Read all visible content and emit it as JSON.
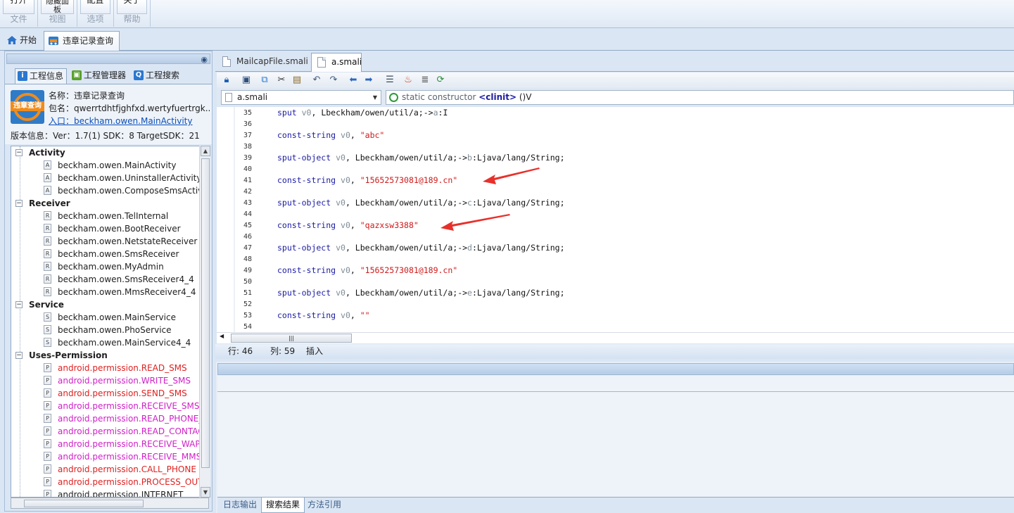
{
  "ribbon": {
    "groups": [
      {
        "button": "打开",
        "label": "文件"
      },
      {
        "button": "隐藏面板",
        "label": "视图"
      },
      {
        "button": "配置",
        "label": "选项"
      },
      {
        "button": "关于",
        "label": "帮助"
      }
    ]
  },
  "top_tabs": {
    "home": "开始",
    "project": "违章记录查询"
  },
  "left_panel": {
    "tabs": {
      "info": "工程信息",
      "manager": "工程管理器",
      "search": "工程搜索"
    },
    "app": {
      "icon_text": "违章查询",
      "name": "名称：违章记录查询",
      "package": "包名：qwerrtdhtfjghfxd.wertyfuertrgk...",
      "entry": "入口：beckham.owen.MainActivity",
      "version": "版本信息：Ver：1.7(1) SDK：8 TargetSDK：21"
    },
    "tree": {
      "activity": {
        "label": "Activity",
        "items": [
          "beckham.owen.MainActivity",
          "beckham.owen.UninstallerActivity",
          "beckham.owen.ComposeSmsActivity"
        ]
      },
      "receiver": {
        "label": "Receiver",
        "items": [
          "beckham.owen.TelInternal",
          "beckham.owen.BootReceiver",
          "beckham.owen.NetstateReceiver",
          "beckham.owen.SmsReceiver",
          "beckham.owen.MyAdmin",
          "beckham.owen.SmsReceiver4_4",
          "beckham.owen.MmsReceiver4_4"
        ]
      },
      "service": {
        "label": "Service",
        "items": [
          "beckham.owen.MainService",
          "beckham.owen.PhoService",
          "beckham.owen.MainService4_4"
        ]
      },
      "permission": {
        "label": "Uses-Permission",
        "items": [
          "android.permission.READ_SMS",
          "android.permission.WRITE_SMS",
          "android.permission.SEND_SMS",
          "android.permission.RECEIVE_SMS",
          "android.permission.READ_PHONE_STATE",
          "android.permission.READ_CONTACTS",
          "android.permission.RECEIVE_WAP_PUSH",
          "android.permission.RECEIVE_MMS",
          "android.permission.CALL_PHONE",
          "android.permission.PROCESS_OUTGOING_CALLS",
          "android.permission.INTERNET"
        ]
      },
      "icon_letters": {
        "activity": "A",
        "receiver": "R",
        "service": "S",
        "permission": "P"
      },
      "expanded_glyph": "⊟"
    }
  },
  "editor": {
    "tabs": [
      "MailcapFile.smali",
      "a.smali"
    ],
    "file_combo": "a.smali",
    "method_combo": {
      "prefix": "static constructor ",
      "name": "<clinit>",
      "suffix": " ()V"
    },
    "lines": [
      {
        "n": "35",
        "kw": "sput",
        "reg": "v0",
        "rest": ", Lbeckham/owen/util/a;->",
        "field": "a",
        "type": ":I"
      },
      {
        "n": "36"
      },
      {
        "n": "37",
        "kw": "const-string",
        "reg": "v0",
        "rest": ", ",
        "str": "\"abc\""
      },
      {
        "n": "38"
      },
      {
        "n": "39",
        "kw": "sput-object",
        "reg": "v0",
        "rest": ", Lbeckham/owen/util/a;->",
        "field": "b",
        "type": ":Ljava/lang/String;"
      },
      {
        "n": "40"
      },
      {
        "n": "41",
        "kw": "const-string",
        "reg": "v0",
        "rest": ", ",
        "str": "\"15652573081@189.cn\""
      },
      {
        "n": "42"
      },
      {
        "n": "43",
        "kw": "sput-object",
        "reg": "v0",
        "rest": ", Lbeckham/owen/util/a;->",
        "field": "c",
        "type": ":Ljava/lang/String;"
      },
      {
        "n": "44"
      },
      {
        "n": "45",
        "kw": "const-string",
        "reg": "v0",
        "rest": ", ",
        "str": "\"qazxsw3388\""
      },
      {
        "n": "46"
      },
      {
        "n": "47",
        "kw": "sput-object",
        "reg": "v0",
        "rest": ", Lbeckham/owen/util/a;->",
        "field": "d",
        "type": ":Ljava/lang/String;"
      },
      {
        "n": "48"
      },
      {
        "n": "49",
        "kw": "const-string",
        "reg": "v0",
        "rest": ", ",
        "str": "\"15652573081@189.cn\""
      },
      {
        "n": "50"
      },
      {
        "n": "51",
        "kw": "sput-object",
        "reg": "v0",
        "rest": ", Lbeckham/owen/util/a;->",
        "field": "e",
        "type": ":Ljava/lang/String;"
      },
      {
        "n": "52"
      },
      {
        "n": "53",
        "kw": "const-string",
        "reg": "v0",
        "rest": ", ",
        "str": "\"\""
      },
      {
        "n": "54"
      }
    ],
    "status": {
      "row": "行: 46",
      "col": "列: 59",
      "mode": "插入"
    }
  },
  "bottom_tabs": [
    "日志输出",
    "搜索结果",
    "方法引用"
  ],
  "colors": {
    "accent": "#8fa9c6",
    "keyword": "#1c1ca3",
    "string": "#d01a1a",
    "permission_red": "#e02020",
    "permission_magenta": "#d020c8",
    "annotation_arrow": "#e8302a"
  }
}
